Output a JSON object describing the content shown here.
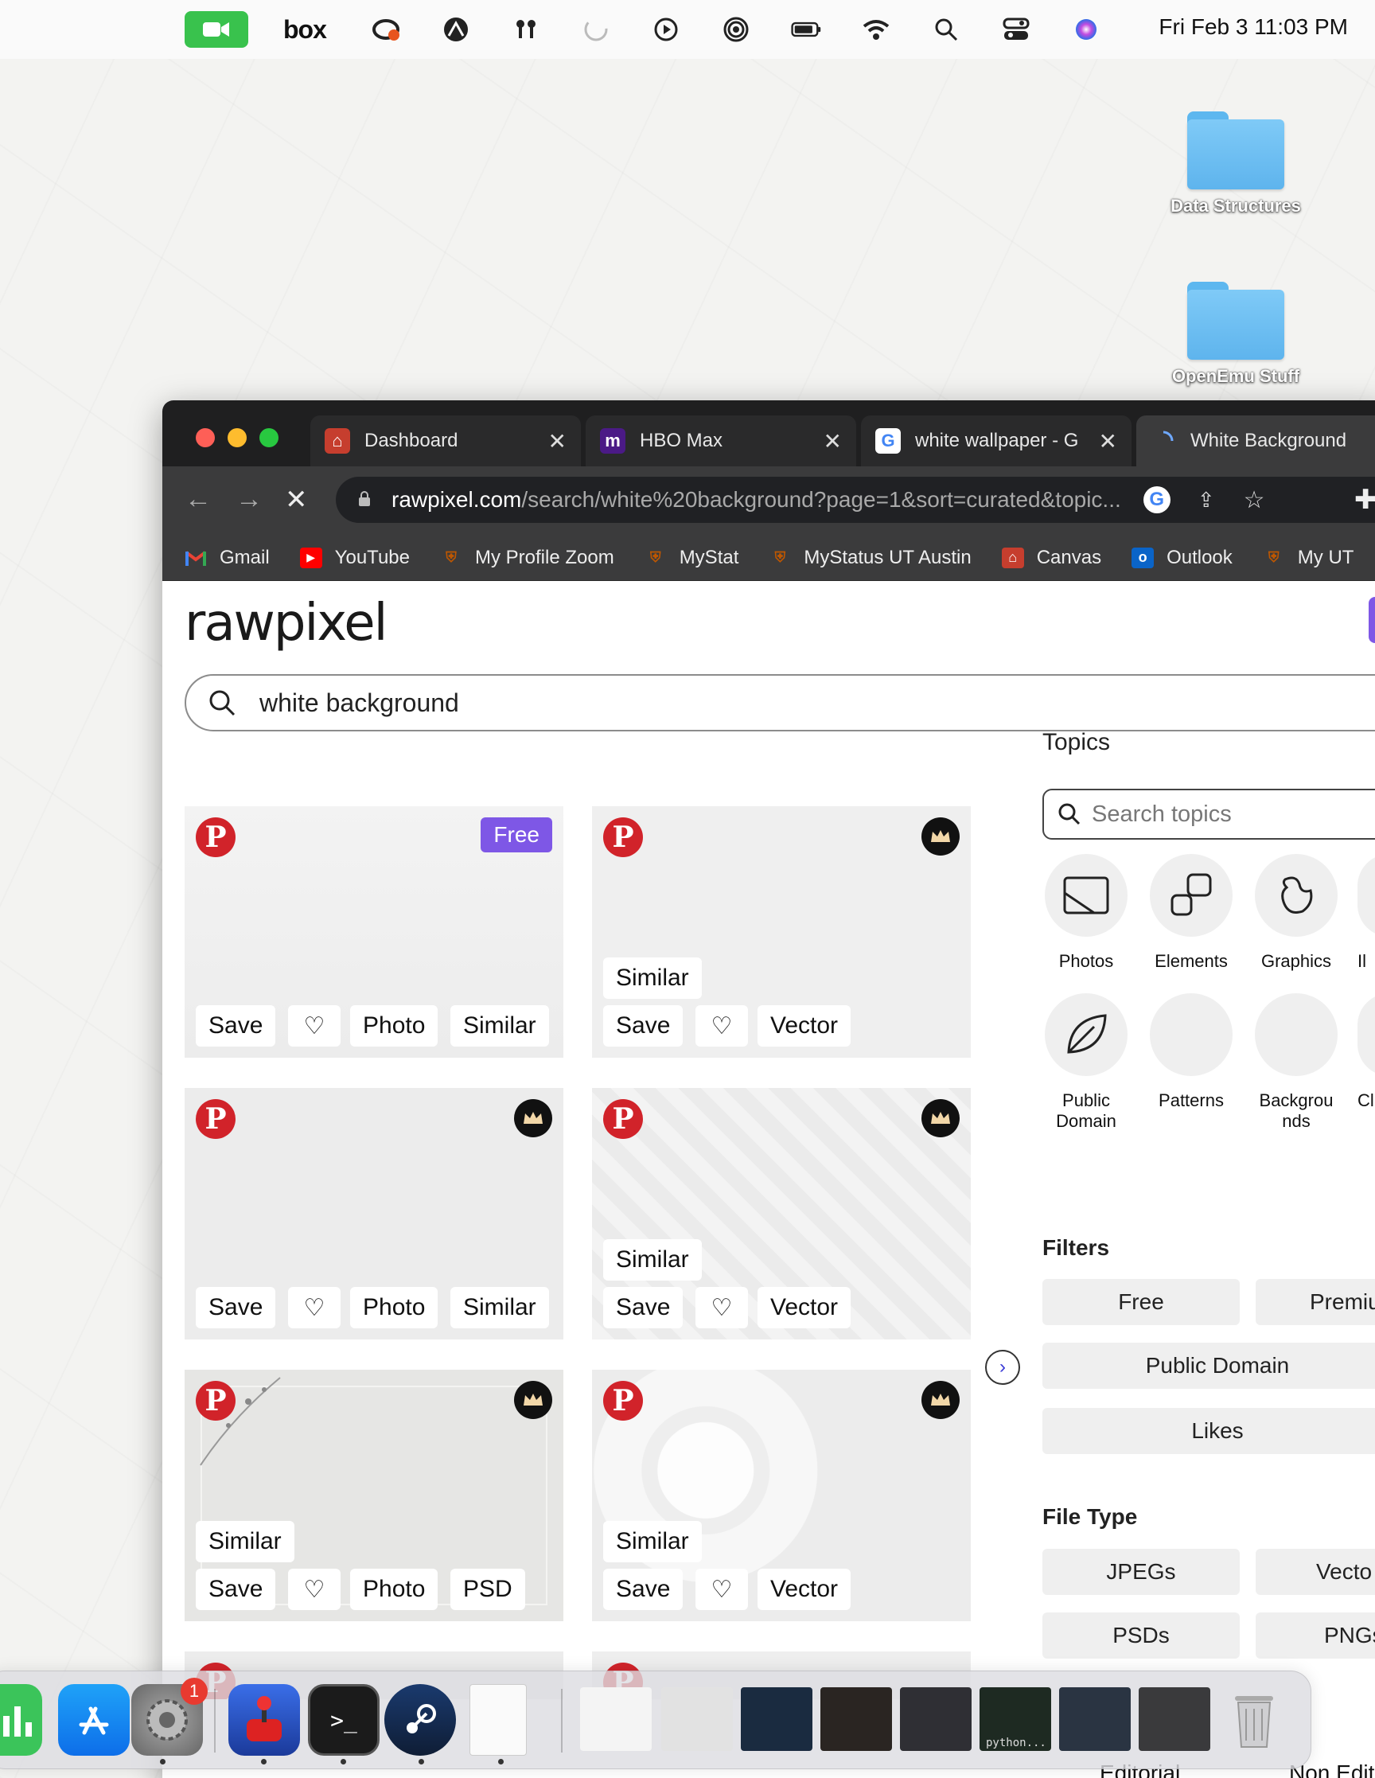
{
  "menubar": {
    "box_label": "box",
    "clock": "Fri Feb 3  11:03 PM"
  },
  "desktop": {
    "folders": [
      {
        "label": "Data Structures"
      },
      {
        "label": "OpenEmu Stuff"
      }
    ]
  },
  "browser": {
    "tabs": [
      {
        "label": "Dashboard",
        "icon": "canvas-icon"
      },
      {
        "label": "HBO Max",
        "icon": "hbo-max-icon"
      },
      {
        "label": "white wallpaper - G",
        "icon": "google-icon"
      },
      {
        "label": "White Background",
        "icon": "loading-icon"
      }
    ],
    "url_host": "rawpixel.com",
    "url_path": "/search/white%20background?page=1&sort=curated&topic...",
    "bookmarks": [
      {
        "label": "Gmail",
        "icon": "gmail-icon"
      },
      {
        "label": "YouTube",
        "icon": "youtube-icon"
      },
      {
        "label": "My Profile Zoom",
        "icon": "ut-shield-icon"
      },
      {
        "label": "MyStat",
        "icon": "ut-shield-icon"
      },
      {
        "label": "MyStatus UT Austin",
        "icon": "ut-shield-icon"
      },
      {
        "label": "Canvas",
        "icon": "canvas-icon"
      },
      {
        "label": "Outlook",
        "icon": "outlook-icon"
      },
      {
        "label": "My UT",
        "icon": "ut-shield-icon"
      }
    ]
  },
  "page": {
    "logo": "rawpixel",
    "search_value": "white background",
    "results": [
      {
        "badge": "Free",
        "similar_top": "",
        "actions": [
          "Save",
          "Photo",
          "Similar"
        ]
      },
      {
        "badge": "premium",
        "similar_top": "Similar",
        "actions": [
          "Save",
          "Vector"
        ]
      },
      {
        "badge": "premium",
        "similar_top": "",
        "actions": [
          "Save",
          "Photo",
          "Similar"
        ]
      },
      {
        "badge": "premium",
        "similar_top": "Similar",
        "actions": [
          "Save",
          "Vector"
        ]
      },
      {
        "badge": "premium",
        "similar_top": "Similar",
        "actions": [
          "Save",
          "Photo",
          "PSD"
        ]
      },
      {
        "badge": "premium",
        "similar_top": "Similar",
        "actions": [
          "Save",
          "Vector"
        ]
      }
    ],
    "sidebar": {
      "topics_title": "Topics",
      "topics_search_placeholder": "Search topics",
      "topics": [
        {
          "label": "Photos",
          "icon": "photo-icon"
        },
        {
          "label": "Elements",
          "icon": "elements-icon"
        },
        {
          "label": "Graphics",
          "icon": "graphics-icon"
        },
        {
          "label": "Il",
          "icon": ""
        },
        {
          "label": "Public Domain",
          "icon": "leaf-icon"
        },
        {
          "label": "Patterns",
          "icon": ""
        },
        {
          "label": "Backgrou nds",
          "icon": ""
        },
        {
          "label": "Cl",
          "icon": ""
        }
      ],
      "filters_title": "Filters",
      "filters": [
        "Free",
        "Premiu",
        "Public Domain",
        "Likes"
      ],
      "filetype_title": "File Type",
      "filetypes": [
        "JPEGs",
        "Vecto",
        "PSDs",
        "PNGs"
      ]
    }
  },
  "dock": {
    "settings_badge": "1",
    "thumb_caption": "python..."
  },
  "behind_dock": [
    "Editorial",
    "Non Edit"
  ]
}
